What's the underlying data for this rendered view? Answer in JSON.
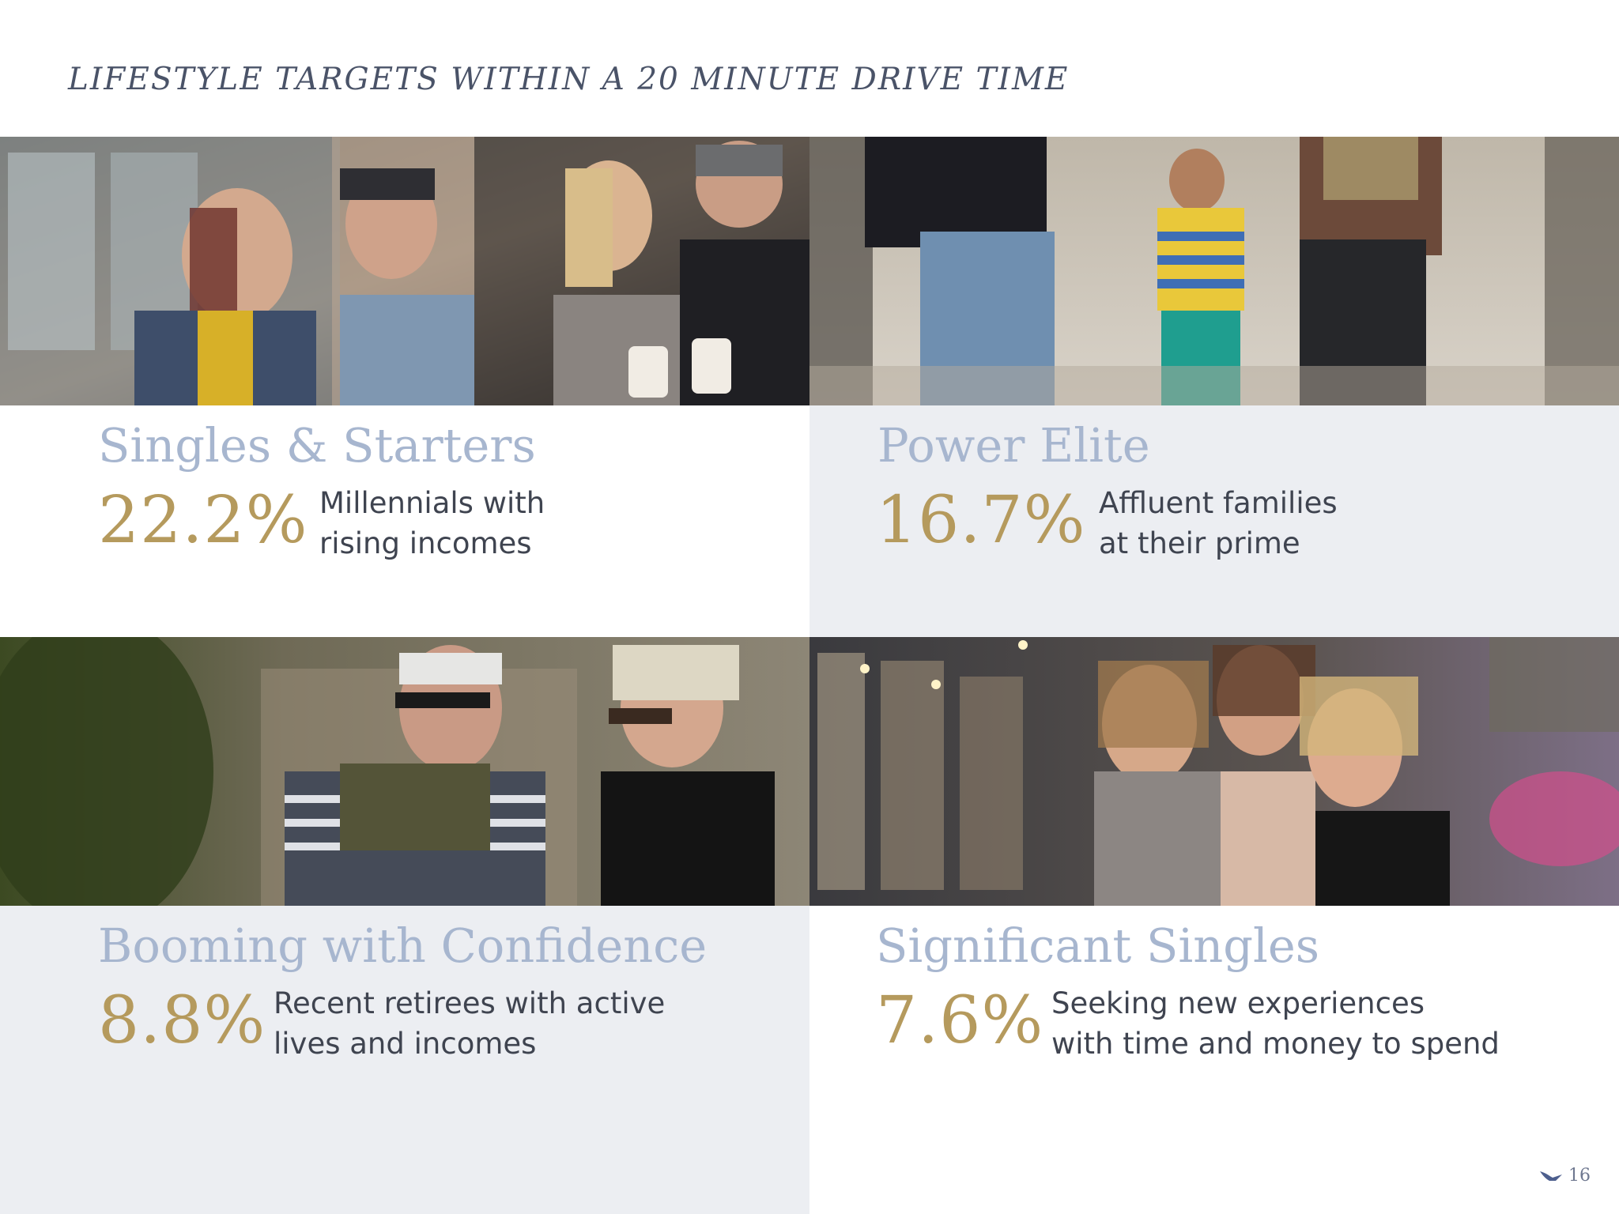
{
  "title": "LIFESTYLE TARGETS WITHIN A 20 MINUTE DRIVE TIME",
  "colors": {
    "segment_name": "#a7b6cf",
    "percent": "#b59a5d",
    "description": "#3f4450",
    "panel_gray": "#eceef2"
  },
  "segments": [
    {
      "name": "Singles & Starters",
      "percent": "22.2%",
      "description_line1": "Millennials with",
      "description_line2": "rising incomes",
      "photo_icon": "friends-cafe-photo"
    },
    {
      "name": "Power Elite",
      "percent": "16.7%",
      "description_line1": "Affluent families",
      "description_line2": "at their prime",
      "photo_icon": "family-walking-photo"
    },
    {
      "name": "Booming with Confidence",
      "percent": "8.8%",
      "description_line1": "Recent retirees with active",
      "description_line2": "lives and incomes",
      "photo_icon": "retired-couple-photo"
    },
    {
      "name": "Significant Singles",
      "percent": "7.6%",
      "description_line1": "Seeking new experiences",
      "description_line2": "with time and money to spend",
      "photo_icon": "women-friends-night-photo"
    }
  ],
  "page_number": "16",
  "footer_icon": "bird-logo-icon"
}
